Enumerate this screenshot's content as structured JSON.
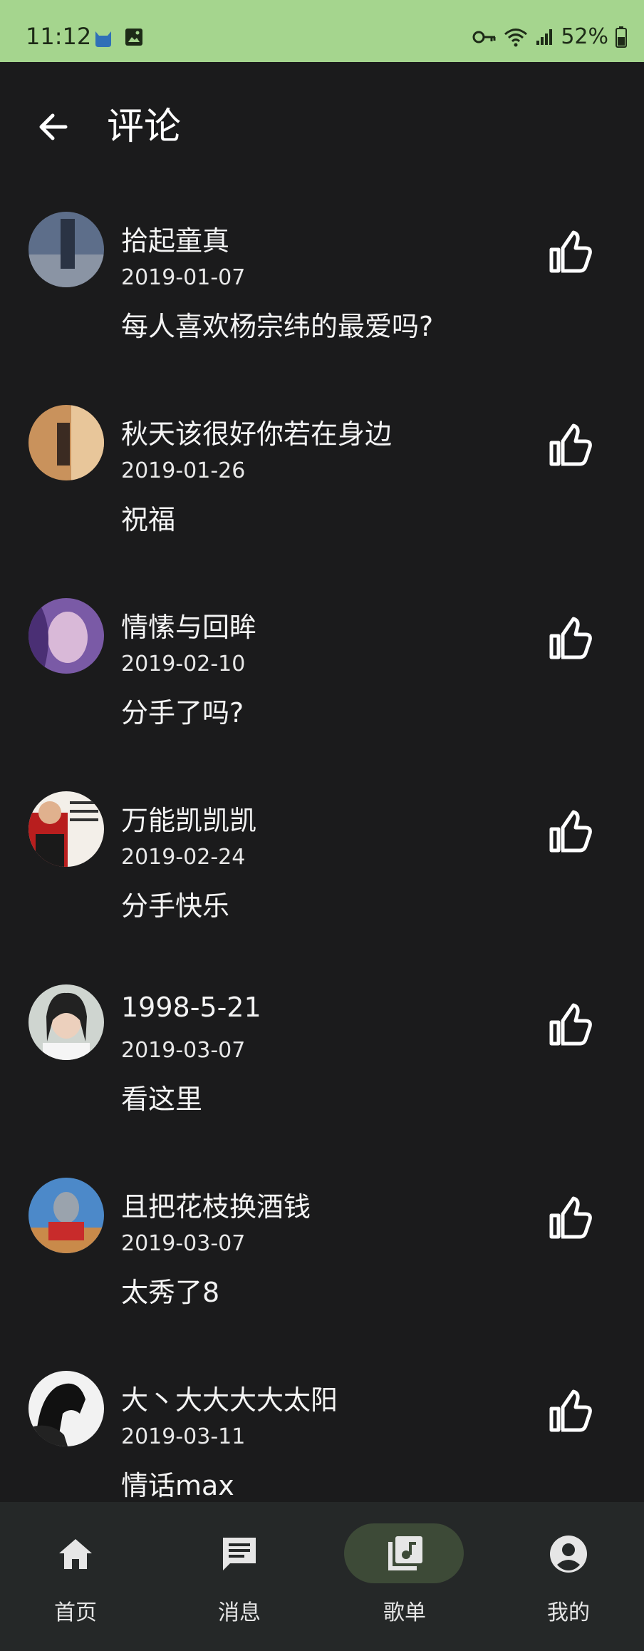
{
  "status_bar": {
    "time": "11:12",
    "battery": "52%"
  },
  "header": {
    "title": "评论"
  },
  "comments": [
    {
      "user": "拾起童真",
      "date": "2019-01-07",
      "text": "每人喜欢杨宗纬的最爱吗?",
      "avatar_color": "#6c7b93"
    },
    {
      "user": "秋天该很好你若在身边",
      "date": "2019-01-26",
      "text": "祝福",
      "avatar_color": "#c9925c"
    },
    {
      "user": "情愫与回眸",
      "date": "2019-02-10",
      "text": "分手了吗?",
      "avatar_color": "#7a5aa6"
    },
    {
      "user": "万能凯凯凯",
      "date": "2019-02-24",
      "text": "分手快乐",
      "avatar_color": "#e9e0d6"
    },
    {
      "user": "1998-5-21",
      "date": "2019-03-07",
      "text": "看这里",
      "avatar_color": "#cfd5d0"
    },
    {
      "user": "且把花枝换酒钱",
      "date": "2019-03-07",
      "text": "太秀了8",
      "avatar_color": "#4c89c9"
    },
    {
      "user": "大丶大大大大太阳",
      "date": "2019-03-11",
      "text": "情话max",
      "avatar_color": "#e6e6e6"
    }
  ],
  "nav": [
    {
      "label": "首页",
      "icon": "home-icon"
    },
    {
      "label": "消息",
      "icon": "message-icon"
    },
    {
      "label": "歌单",
      "icon": "music-library-icon",
      "active": true
    },
    {
      "label": "我的",
      "icon": "account-icon"
    }
  ],
  "colors": {
    "status_bar": "#a5d58e",
    "background": "#1b1b1c",
    "nav_active_pill": "#3d4a37"
  }
}
